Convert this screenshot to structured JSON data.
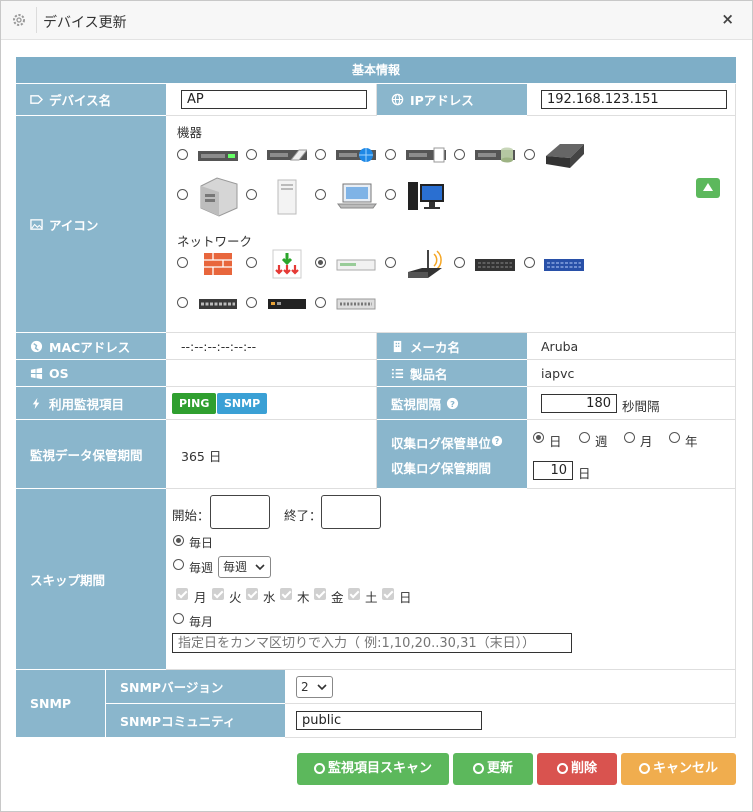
{
  "dialog": {
    "title": "デバイス更新",
    "close": "×"
  },
  "section": {
    "title": "基本情報"
  },
  "device_name": {
    "label": "デバイス名",
    "value": "AP"
  },
  "ip": {
    "label": "IPアドレス",
    "value": "192.168.123.151"
  },
  "icon": {
    "label": "アイコン",
    "group_machines": "機器",
    "group_network": "ネットワーク",
    "machine_icons": [
      "rack-server-icon",
      "rack-server-hdd-icon",
      "rack-server-globe-icon",
      "rack-server-doc-icon",
      "rack-server-db-icon",
      "nas-box-icon",
      "server-tower-icon",
      "white-tower-pc-icon",
      "laptop-icon",
      "desktop-pc-icon"
    ],
    "network_icons": [
      "firewall-icon",
      "router-arrows-icon",
      "switch-white-icon",
      "wifi-router-icon",
      "switch-black-icon",
      "switch-blue-icon",
      "switch-small-icon",
      "switch-black-small-icon",
      "switch-gray-icon"
    ],
    "selected": "switch-white-icon"
  },
  "mac": {
    "label": "MACアドレス",
    "value": "--:--:--:--:--:--"
  },
  "maker": {
    "label": "メーカ名",
    "value": "Aruba"
  },
  "os": {
    "label": "OS",
    "value": ""
  },
  "product": {
    "label": "製品名",
    "value": "iapvc"
  },
  "monitor_items": {
    "label": "利用監視項目",
    "badges": [
      "PING",
      "SNMP"
    ],
    "colors": [
      "#2f9f2f",
      "#3aa0d5"
    ]
  },
  "monitor_interval": {
    "label": "監視間隔",
    "value": "180",
    "unit": "秒間隔"
  },
  "retention": {
    "label": "監視データ保管期間",
    "value": "365 日"
  },
  "log_unit": {
    "label": "収集ログ保管単位",
    "options": [
      "日",
      "週",
      "月",
      "年"
    ],
    "selected": "日"
  },
  "log_period": {
    "label": "収集ログ保管期間",
    "value": "10",
    "unit": "日"
  },
  "skip": {
    "label": "スキップ期間",
    "start_label": "開始：",
    "end_label": "終了：",
    "daily": "毎日",
    "weekly": "毎週",
    "weekly_select": "毎週",
    "days": [
      "月",
      "火",
      "水",
      "木",
      "金",
      "土",
      "日"
    ],
    "monthly": "毎月",
    "monthly_placeholder": "指定日をカンマ区切りで入力（ 例:1,10,20..30,31（末日））"
  },
  "snmp": {
    "label": "SNMP",
    "version_label": "SNMPバージョン",
    "version_value": "2",
    "community_label": "SNMPコミュニティ",
    "community_value": "public"
  },
  "buttons": {
    "scan": "監視項目スキャン",
    "update": "更新",
    "delete": "削除",
    "cancel": "キャンセル"
  },
  "colors": {
    "header": "#7eaec7",
    "label_bg": "#8ab6cc",
    "scan": "#5cb85c",
    "delete": "#d9534f",
    "cancel": "#f0ad4e"
  }
}
